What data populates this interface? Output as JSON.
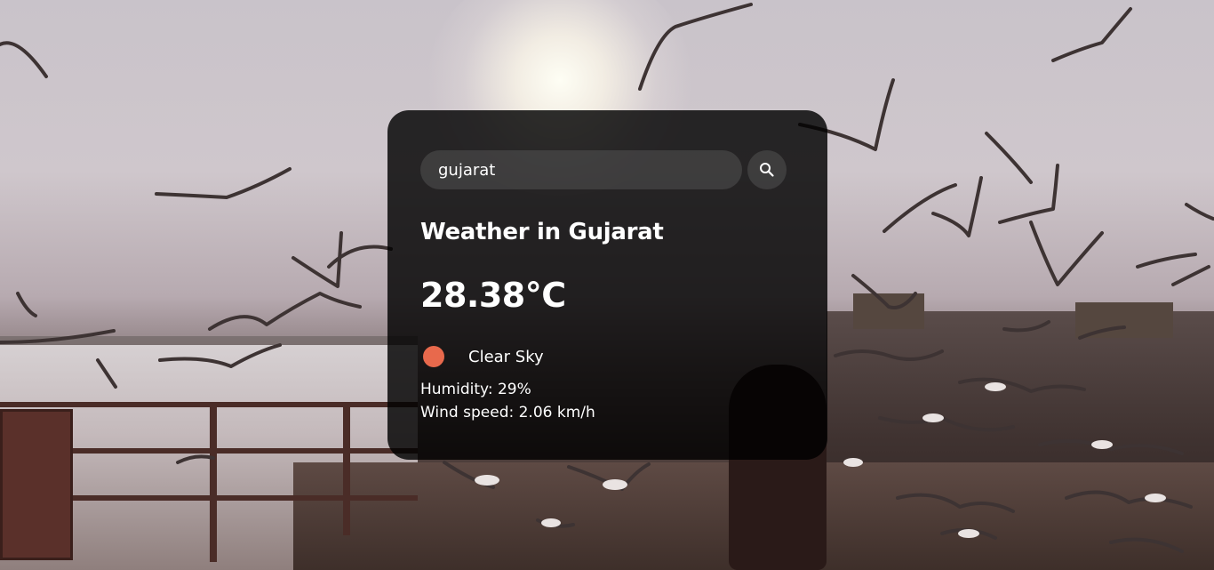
{
  "search": {
    "value": "gujarat",
    "button_icon": "search-icon"
  },
  "weather": {
    "city_heading": "Weather in Gujarat",
    "temperature": "28.38°C",
    "icon": "clear-sky-sun-icon",
    "icon_color": "#e8694c",
    "description": "Clear Sky",
    "humidity": "Humidity: 29%",
    "wind": "Wind speed: 2.06 km/h"
  },
  "background": {
    "subject": "seagulls-over-riverside-ghat-photo"
  }
}
